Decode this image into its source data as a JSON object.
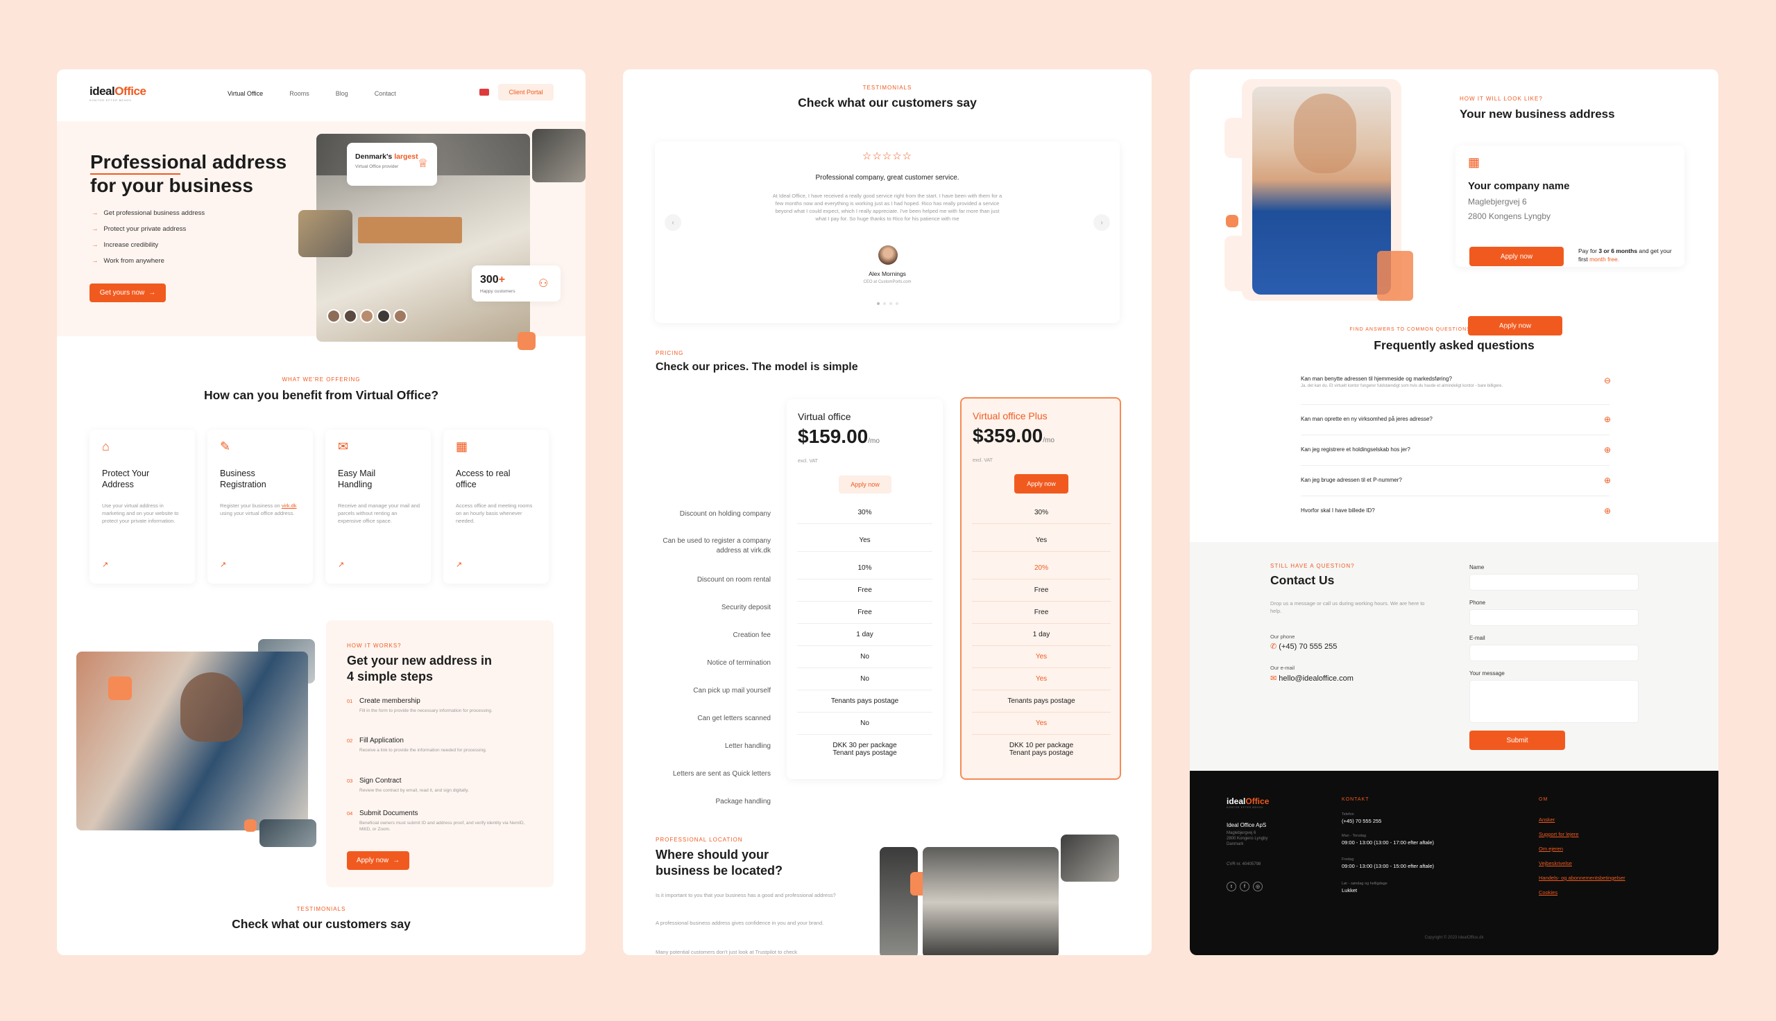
{
  "colors": {
    "background": "#fde5d9",
    "accent": "#f15a1f",
    "footer_bg": "#0d0d0d"
  },
  "home": {
    "logo": {
      "brand": "idealOffice",
      "tagline": "KONTOR EFTER BEHOV"
    },
    "nav": [
      "Virtual Office",
      "Rooms",
      "Blog",
      "Contact"
    ],
    "client_portal": "Client Portal",
    "hero": {
      "title_line1": "Professional address",
      "title_line2": "for your business",
      "bullets": [
        "Get professional business address",
        "Protect your private address",
        "Increase credibility",
        "Work from anywhere"
      ],
      "cta": "Get yours now",
      "badge_title_a": "Denmark's",
      "badge_title_b": "largest",
      "badge_sub": "Virtual Office provider",
      "stat_value": "300",
      "stat_plus": "+",
      "stat_label": "Happy customers"
    },
    "benefits": {
      "eyebrow": "WHAT WE'RE OFFERING",
      "title": "How can you benefit from Virtual Office?",
      "cards": [
        {
          "title_a": "Protect Your",
          "title_b": "Address",
          "text": "Use your virtual address in marketing and on your website to protect your private information."
        },
        {
          "title_a": "Business",
          "title_b": "Registration",
          "text_a": "Register your business on",
          "link": "virk.dk",
          "text_b": "using your virtual office address."
        },
        {
          "title_a": "Easy Mail",
          "title_b": "Handling",
          "text": "Receive and manage your mail and parcels without renting an expensive office space."
        },
        {
          "title_a": "Access to real",
          "title_b": "office",
          "text": "Access office and meeting rooms on an hourly basis whenever needed."
        }
      ]
    },
    "steps": {
      "eyebrow": "HOW IT WORKS?",
      "title_line1": "Get your new address in",
      "title_line2": "4 simple steps",
      "items": [
        {
          "num": "01",
          "title": "Create membership",
          "text": "Fill in the form to provide the necessary information for processing."
        },
        {
          "num": "02",
          "title": "Fill Application",
          "text": "Receive a link to provide the information needed for processing."
        },
        {
          "num": "03",
          "title": "Sign Contract",
          "text": "Review the contract by email, read it, and sign digitally."
        },
        {
          "num": "04",
          "title": "Submit Documents",
          "text": "Beneficial owners must submit ID and address proof, and verify identity via NemID, MitID, or Zoom."
        }
      ],
      "cta": "Apply now"
    },
    "testimonials_teaser": {
      "eyebrow": "TESTIMONIALS",
      "title": "Check what our customers say"
    }
  },
  "pricing_page": {
    "testimonials": {
      "eyebrow": "TESTIMONIALS",
      "title": "Check what our customers say",
      "stars": "☆☆☆☆☆",
      "quote_title": "Professional company, great customer service.",
      "quote": "At Ideal Office, I have received a really good service right from the start. I have been with them for a few months now and everything is working just as I had hoped. Rico has really provided a service beyond what I could expect, which I really appreciate. I've been helped me with far more than just what I pay for. So huge thanks to Rico for his patience with me",
      "author": "Alex Mornings",
      "author_role": "CEO at CustomPorts.com"
    },
    "pricing": {
      "eyebrow": "PRICING",
      "title": "Check our prices. The model is simple",
      "features": [
        "Discount on holding company",
        "Can be used to register a company address at virk.dk",
        "Discount on room rental",
        "Security deposit",
        "Creation fee",
        "Notice of termination",
        "Can pick up mail yourself",
        "Can get letters scanned",
        "Letter handling",
        "Letters are sent as Quick letters",
        "Package handling"
      ],
      "plans": [
        {
          "name": "Virtual office",
          "price": "$159.00",
          "per": "/mo",
          "vat": "excl. VAT",
          "cta": "Apply now",
          "values": [
            "30%",
            "Yes",
            "10%",
            "Free",
            "Free",
            "1 day",
            "No",
            "No",
            "Tenants pays postage",
            "No",
            "DKK 30 per package\nTenant pays postage"
          ]
        },
        {
          "name": "Virtual office Plus",
          "price": "$359.00",
          "per": "/mo",
          "vat": "excl. VAT",
          "cta": "Apply now",
          "values": [
            "30%",
            "Yes",
            "20%",
            "Free",
            "Free",
            "1 day",
            "Yes",
            "Yes",
            "Tenants pays postage",
            "Yes",
            "DKK 10 per package\nTenant pays postage"
          ]
        }
      ]
    },
    "location": {
      "eyebrow": "PROFESSIONAL LOCATION",
      "title_line1": "Where should your",
      "title_line2": "business be located?",
      "p1": "Is it important to you that your business has a good and professional address?",
      "p2": "A professional business address gives confidence in you and your brand.",
      "p3": "Many potential customers don't just look at Trustpilot to check"
    }
  },
  "address_page": {
    "preview": {
      "eyebrow": "HOW IT WILL LOOK LIKE?",
      "title": "Your new business address",
      "company": "Your company name",
      "street": "Maglebjergvej 6",
      "city": "2800 Kongens Lyngby",
      "cta": "Apply now",
      "note_a": "Pay for",
      "note_b": "3 or 6 months",
      "note_c": "and get your first",
      "note_d": "month free."
    },
    "faq": {
      "eyebrow": "FIND ANSWERS TO COMMON QUESTIONS ABOUT OUR VIRTUAL OFFICE",
      "title": "Frequently asked questions",
      "items": [
        {
          "q": "Kan man benytte adressen til hjemmeside og markedsføring?",
          "a": "Ja, det kan du. Et virtuelt kontor fungerer fuldstændigt som hvis du havde et almindeligt kontor - bare billigere."
        },
        {
          "q": "Kan man oprette en ny virksomhed på jeres adresse?"
        },
        {
          "q": "Kan jeg registrere et holdingselskab hos jer?"
        },
        {
          "q": "Kan jeg bruge adressen til et P-nummer?"
        },
        {
          "q": "Hvorfor skal I have billede ID?"
        }
      ]
    },
    "contact": {
      "eyebrow": "STILL HAVE A QUESTION?",
      "title": "Contact Us",
      "text": "Drop us a message or call us during working hours. We are here to help.",
      "phone_label": "Our phone",
      "phone": "(+45) 70 555 255",
      "email_label": "Our e-mail",
      "email": "hello@idealoffice.com",
      "fields": [
        "Name",
        "Phone",
        "E-mail",
        "Your message"
      ],
      "submit": "Submit"
    },
    "footer": {
      "company": "Ideal Office ApS",
      "address_lines": [
        "Maglebjergvej 6",
        "2800 Kongens Lyngby",
        "Danmark"
      ],
      "cvr": "CVR nr. 40405798",
      "col2_title": "KONTAKT",
      "phone_label": "Telefon",
      "phone": "(+45) 70 555 255",
      "hours_label_1": "Man - Torsdag",
      "hours_1": "09:00 - 13:00 (13:00 - 17:00 efter aftale)",
      "hours_label_2": "Fredag",
      "hours_2": "09:00 - 13:00 (13:00 - 15:00 efter aftale)",
      "hours_label_3": "Lør - søndag og helligdage",
      "hours_3": "Lukket",
      "col3_title": "OM",
      "links": [
        "Ansker",
        "Support for lejere",
        "Om ejeren",
        "Vejbeskrivelse",
        "Handels- og abonnementsbetingelser",
        "Cookies"
      ],
      "copyright": "Copyright © 2023 IdealOffice.dk"
    }
  }
}
